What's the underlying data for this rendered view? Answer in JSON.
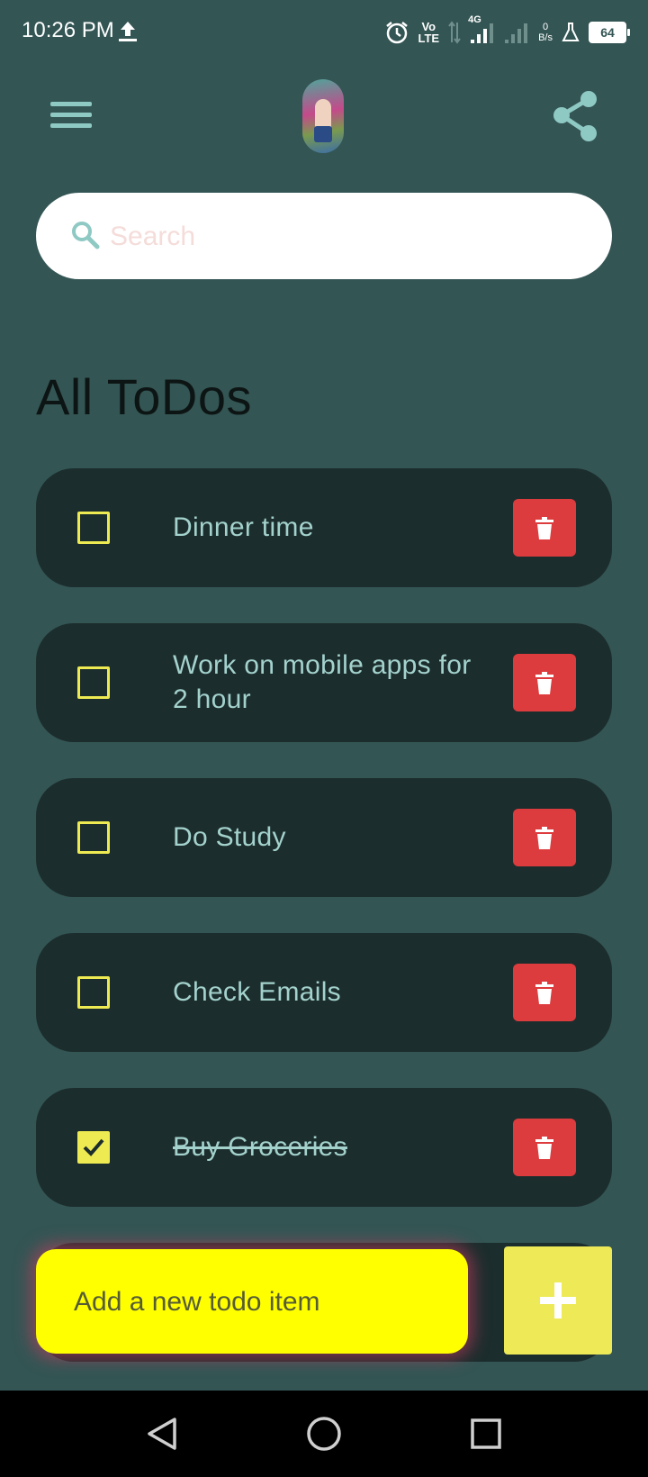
{
  "status_bar": {
    "time": "10:26 PM",
    "volte_top": "Vo",
    "volte_bottom": "LTE",
    "network": "4G",
    "speed_value": "0",
    "speed_unit": "B/s",
    "battery": "64"
  },
  "app_bar": {
    "menu_icon": "hamburger-menu-icon",
    "avatar": "profile-photo",
    "share_icon": "share-icon"
  },
  "search": {
    "placeholder": "Search",
    "value": ""
  },
  "page_title": "All ToDos",
  "todos": [
    {
      "text": "Dinner time",
      "done": false
    },
    {
      "text": "Work on mobile apps for 2 hour",
      "done": false
    },
    {
      "text": "Do Study",
      "done": false
    },
    {
      "text": "Check Emails",
      "done": false
    },
    {
      "text": "Buy Groceries",
      "done": true
    }
  ],
  "add_todo": {
    "placeholder": "Add a new todo item",
    "value": "",
    "button_icon": "plus-icon"
  },
  "colors": {
    "background": "#335554",
    "card": "#1c2d2d",
    "checkbox": "#eeeb52",
    "delete": "#dd3c3e",
    "todo_text": "#a3d2cd",
    "add_input": "#ffff00",
    "add_button": "#ede957"
  }
}
